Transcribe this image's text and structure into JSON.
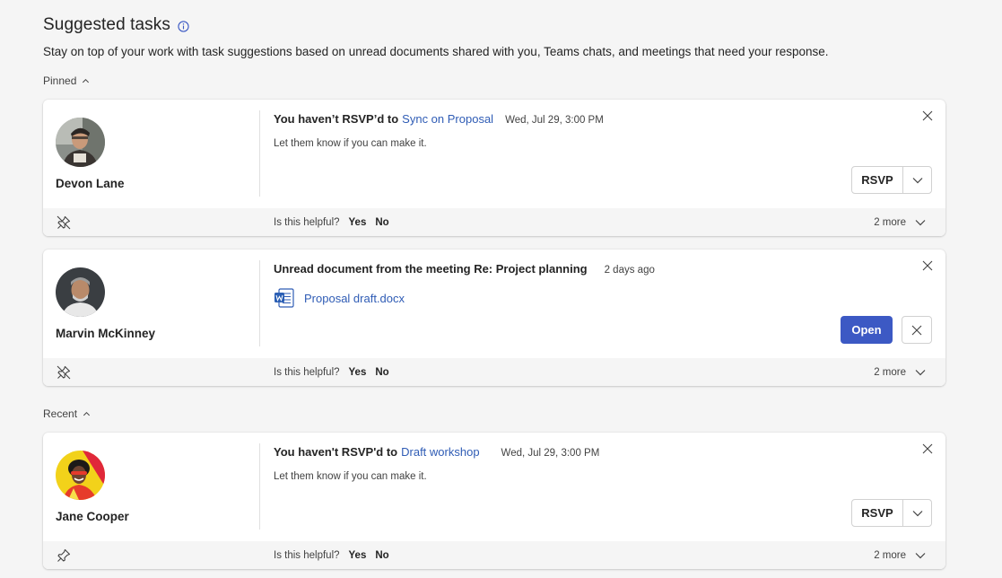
{
  "header": {
    "title": "Suggested tasks",
    "subtitle": "Stay on top of your work with task suggestions based on unread documents shared with you, Teams chats, and meetings that need your response."
  },
  "sections": {
    "pinned": "Pinned",
    "recent": "Recent"
  },
  "cards": [
    {
      "person": "Devon Lane",
      "task_title": "You haven’t RSVP’d to",
      "link": "Sync on Proposal",
      "time": "Wed, Jul 29, 3:00 PM",
      "description": "Let them know if you can make it.",
      "action": "RSVP",
      "helpful": "Is this helpful?",
      "yes": "Yes",
      "no": "No",
      "more": "2 more"
    },
    {
      "person": "Marvin McKinney",
      "task_title": "Unread document from the meeting Re: Project planning",
      "time": "2 days ago",
      "document": "Proposal draft.docx",
      "action": "Open",
      "helpful": "Is this helpful?",
      "yes": "Yes",
      "no": "No",
      "more": "2 more"
    },
    {
      "person": "Jane Cooper",
      "task_title": "You haven't RSVP'd to",
      "link": "Draft workshop",
      "time": "Wed, Jul 29, 3:00 PM",
      "description": "Let them know if you can make it.",
      "action": "RSVP",
      "helpful": "Is this helpful?",
      "yes": "Yes",
      "no": "No",
      "more": "2 more"
    }
  ],
  "colors": {
    "accent": "#3c59c4",
    "link": "#2f5cb5",
    "background": "#f5f5f5"
  },
  "icons": [
    "info-icon",
    "chevron-up-icon",
    "close-icon",
    "chevron-down-icon",
    "unpin-icon",
    "pin-icon",
    "word-doc-icon"
  ]
}
